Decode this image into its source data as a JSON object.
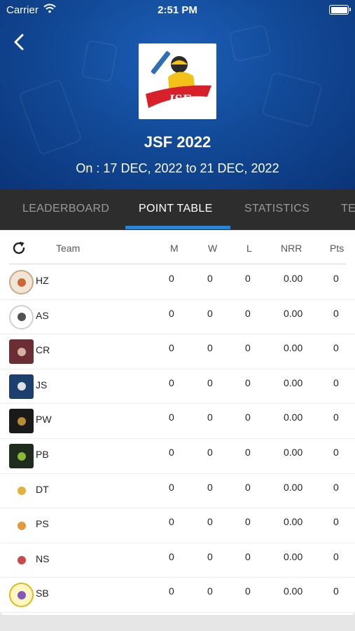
{
  "status_bar": {
    "carrier": "Carrier",
    "time": "2:51 PM"
  },
  "tournament": {
    "name": "JSF 2022",
    "dates": "On : 17 DEC, 2022 to 21 DEC, 2022",
    "logo_text": "JSF"
  },
  "tabs": [
    {
      "label": "LEADERBOARD",
      "active": false
    },
    {
      "label": "POINT TABLE",
      "active": true
    },
    {
      "label": "STATISTICS",
      "active": false
    },
    {
      "label": "TEAMS",
      "active": false
    }
  ],
  "table": {
    "headers": {
      "team": "Team",
      "m": "M",
      "w": "W",
      "l": "L",
      "nrr": "NRR",
      "pts": "Pts"
    },
    "rows": [
      {
        "team": "HZ",
        "m": "0",
        "w": "0",
        "l": "0",
        "nrr": "0.00",
        "pts": "0"
      },
      {
        "team": "AS",
        "m": "0",
        "w": "0",
        "l": "0",
        "nrr": "0.00",
        "pts": "0"
      },
      {
        "team": "CR",
        "m": "0",
        "w": "0",
        "l": "0",
        "nrr": "0.00",
        "pts": "0"
      },
      {
        "team": "JS",
        "m": "0",
        "w": "0",
        "l": "0",
        "nrr": "0.00",
        "pts": "0"
      },
      {
        "team": "PW",
        "m": "0",
        "w": "0",
        "l": "0",
        "nrr": "0.00",
        "pts": "0"
      },
      {
        "team": "PB",
        "m": "0",
        "w": "0",
        "l": "0",
        "nrr": "0.00",
        "pts": "0"
      },
      {
        "team": "DT",
        "m": "0",
        "w": "0",
        "l": "0",
        "nrr": "0.00",
        "pts": "0"
      },
      {
        "team": "PS",
        "m": "0",
        "w": "0",
        "l": "0",
        "nrr": "0.00",
        "pts": "0"
      },
      {
        "team": "NS",
        "m": "0",
        "w": "0",
        "l": "0",
        "nrr": "0.00",
        "pts": "0"
      },
      {
        "team": "SB",
        "m": "0",
        "w": "0",
        "l": "0",
        "nrr": "0.00",
        "pts": "0"
      }
    ]
  },
  "colors": {
    "header_blue": "#124a98",
    "tab_bar": "#2d2d2d",
    "tab_indicator": "#1e88e5"
  }
}
